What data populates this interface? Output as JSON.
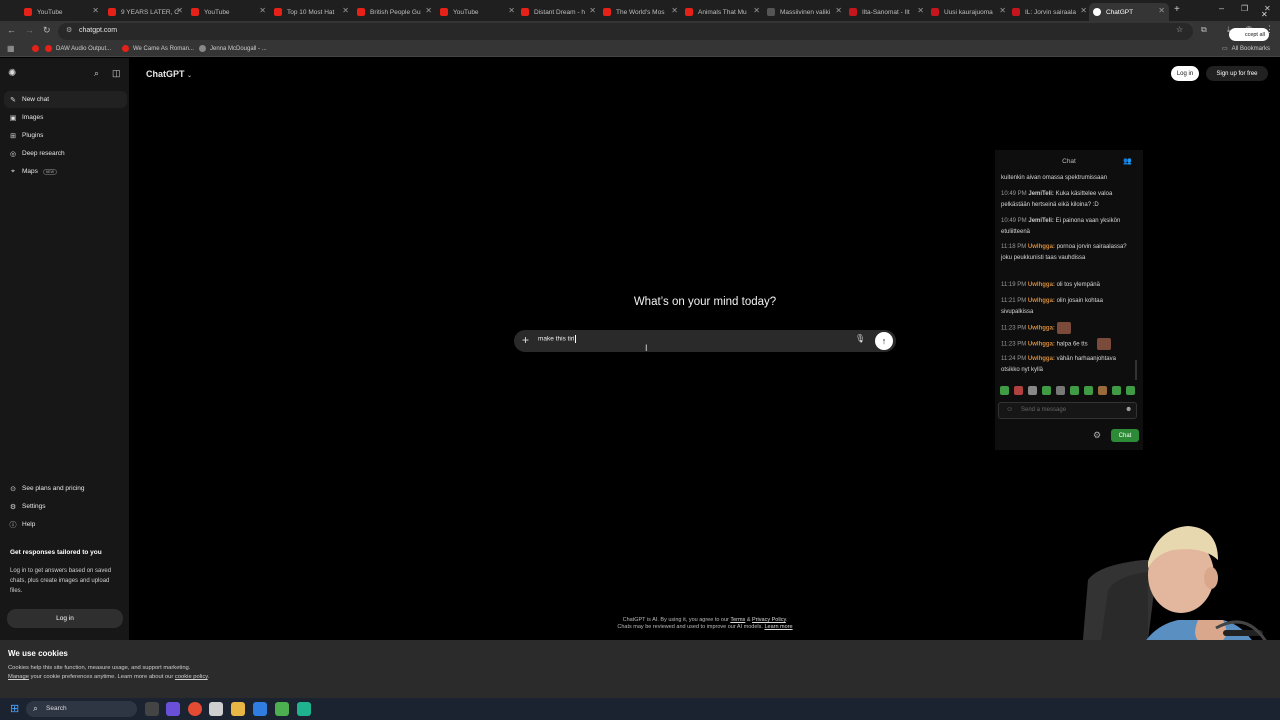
{
  "browser": {
    "tabs": [
      {
        "label": "YouTube"
      },
      {
        "label": "9 YEARS LATER, C"
      },
      {
        "label": "YouTube"
      },
      {
        "label": "Top 10 Most Hat"
      },
      {
        "label": "British People Gu"
      },
      {
        "label": "YouTube"
      },
      {
        "label": "Distant Dream - h"
      },
      {
        "label": "The World's Mos"
      },
      {
        "label": "Animals That Mu"
      },
      {
        "label": "Massiivinen valiki"
      },
      {
        "label": "Ilta-Sanomat - Ilt"
      },
      {
        "label": "Uusi kaurajuoma"
      },
      {
        "label": "IL: Jorvin sairaala"
      },
      {
        "label": "ChatGPT"
      }
    ],
    "url": "chatgpt.com",
    "bookmarks": [
      "DAW Audio Output...",
      "We Came As Roman...",
      "Jenna McDougall - ..."
    ],
    "all_bookmarks": "All Bookmarks"
  },
  "app": {
    "brand": "ChatGPT",
    "login": "Log in",
    "signup": "Sign up for free",
    "headline": "What’s on your mind today?",
    "composer_value": "make this tiri",
    "disclaimer_1": "ChatGPT is AI. By using it, you agree to our",
    "terms": "Terms",
    "and": "&",
    "privacy": "Privacy Policy",
    "disclaimer_2": "Chats may be reviewed and used to improve our AI models.",
    "learn_more": "Learn more"
  },
  "sidebar": {
    "items": [
      {
        "label": "New chat"
      },
      {
        "label": "Images"
      },
      {
        "label": "Plugins"
      },
      {
        "label": "Deep research"
      },
      {
        "label": "Maps"
      }
    ],
    "maps_badge": "NEW",
    "bottom": [
      {
        "label": "See plans and pricing"
      },
      {
        "label": "Settings"
      },
      {
        "label": "Help"
      }
    ],
    "promo_title": "Get responses tailored to you",
    "promo_text": "Log in to get answers based on saved chats, plus create images and upload files.",
    "login": "Log in"
  },
  "cookie": {
    "title": "We use cookies",
    "line1": "Cookies help this site function, measure usage, and support marketing.",
    "line2_a": "Manage",
    "line2_b": " your cookie preferences anytime. Learn more about our ",
    "line2_c": "cookie policy",
    "line2_d": ".",
    "accept": "ccept all"
  },
  "stream_chat": {
    "title": "Chat",
    "messages": [
      {
        "time": "",
        "user": "",
        "text": "kuitenkin aivan omassa spektrumissaan"
      },
      {
        "time": "10:49 PM",
        "user": "JemiTeli:",
        "text": "Kuka käsittelee valoa pelkästään hertseinä eikä kiloina? :D"
      },
      {
        "time": "10:49 PM",
        "user": "JemiTeli:",
        "text": "Ei painona vaan yksikön etuliitteenä"
      },
      {
        "time": "11:18 PM",
        "user": "Uwlhgga:",
        "text": "pornoa jorvin sairaalassa? joku peukkunisti taas vauhdissa"
      },
      {
        "time": "11:19 PM",
        "user": "Uwlhgga:",
        "text": "oli tos ylempänä"
      },
      {
        "time": "11:21 PM",
        "user": "Uwlhgga:",
        "text": "olin josain kohtaa sivupalkissa"
      },
      {
        "time": "11:23 PM",
        "user": "Uwlhgga:",
        "text": ""
      },
      {
        "time": "11:23 PM",
        "user": "Uwlhgga:",
        "text": "halpa 6e tts"
      },
      {
        "time": "11:24 PM",
        "user": "Uwlhgga:",
        "text": "vähän harhaanjohtava otsikko nyt kyllä"
      }
    ],
    "input_placeholder": "Send a message",
    "send": "Chat"
  },
  "taskbar": {
    "search": "Search"
  }
}
